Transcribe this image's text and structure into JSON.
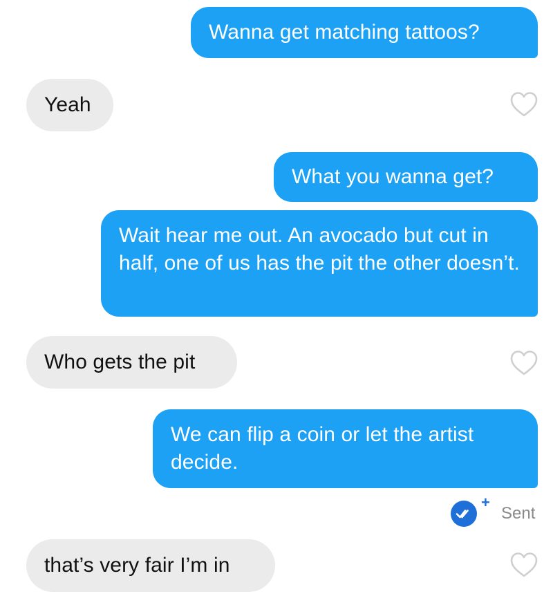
{
  "messages": [
    {
      "direction": "outgoing",
      "text": "Wanna get matching tattoos?"
    },
    {
      "direction": "incoming",
      "text": "Yeah"
    },
    {
      "direction": "outgoing",
      "text": "What you wanna get?"
    },
    {
      "direction": "outgoing",
      "text": "Wait hear me out. An avocado but cut in half, one of us has the pit the other doesn’t."
    },
    {
      "direction": "incoming",
      "text": "Who gets the pit"
    },
    {
      "direction": "outgoing",
      "text": "We can flip a coin or let the artist decide."
    },
    {
      "direction": "incoming",
      "text": "that’s very fair I’m in"
    }
  ],
  "receipt": {
    "status": "Sent",
    "icon": "double-check-icon",
    "badge": "+"
  },
  "icons": {
    "like": "heart-outline-icon"
  },
  "colors": {
    "outgoing_bubble": "#1da1f5",
    "incoming_bubble": "#ebebeb",
    "receipt_circle": "#1f6fd8",
    "heart_stroke": "#cfcfcf"
  }
}
